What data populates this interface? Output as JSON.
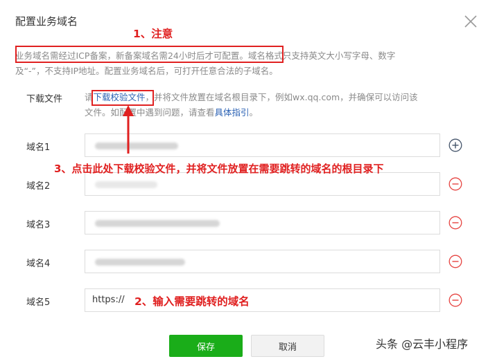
{
  "dialog": {
    "title": "配置业务域名",
    "description_line1": "业务域名需经过ICP备案，新备案域名需24小时后才可配置。域名格式只支持英文大小写字母、数字",
    "description_line2": "及“-”，不支持IP地址。配置业务域名后，可打开任意合法的子域名。"
  },
  "download": {
    "label": "下载文件",
    "prefix": "请",
    "link_text": "下载校验文件",
    "middle": "，并将文件放置在域名根目录下，例如wx.qq.com，并确保可以访问该",
    "line2_prefix": "文件。如配置中遇到问题，请查看",
    "guide_link": "具体指引",
    "line2_suffix": "。"
  },
  "domains": [
    {
      "label": "域名1",
      "value": ""
    },
    {
      "label": "域名2",
      "value": ""
    },
    {
      "label": "域名3",
      "value": ""
    },
    {
      "label": "域名4",
      "value": ""
    },
    {
      "label": "域名5",
      "value": "https://"
    }
  ],
  "annotations": {
    "a1": "1、注意",
    "a2": "2、输入需要跳转的域名",
    "a3": "3、点击此处下载校验文件，并将文件放置在需要跳转的域名的根目录下"
  },
  "buttons": {
    "save": "保存",
    "cancel": "取消"
  },
  "watermark": "头条 @云丰小程序",
  "colors": {
    "primary": "#1aad19",
    "link": "#2b62b4",
    "danger": "#e64340",
    "annotation": "#e02020"
  }
}
